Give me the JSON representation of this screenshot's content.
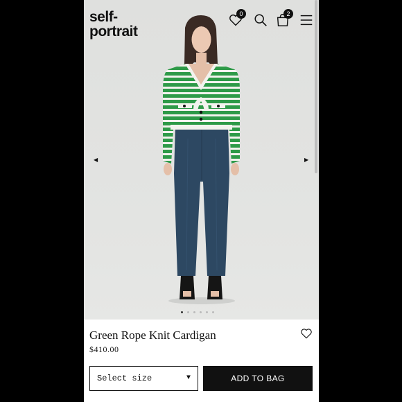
{
  "brand": {
    "line1": "self-",
    "line2": "portrait"
  },
  "header": {
    "wishlist_count": "0",
    "bag_count": "2"
  },
  "product": {
    "name": "Green Rope Knit Cardigan",
    "price": "$410.00"
  },
  "controls": {
    "size_placeholder": "Select size",
    "add_to_bag": "ADD TO BAG"
  },
  "gallery": {
    "slide_count": 6,
    "active_slide": 1
  },
  "colors": {
    "accent": "#111111",
    "cardigan_green": "#2e9a48",
    "denim": "#2d4862"
  }
}
